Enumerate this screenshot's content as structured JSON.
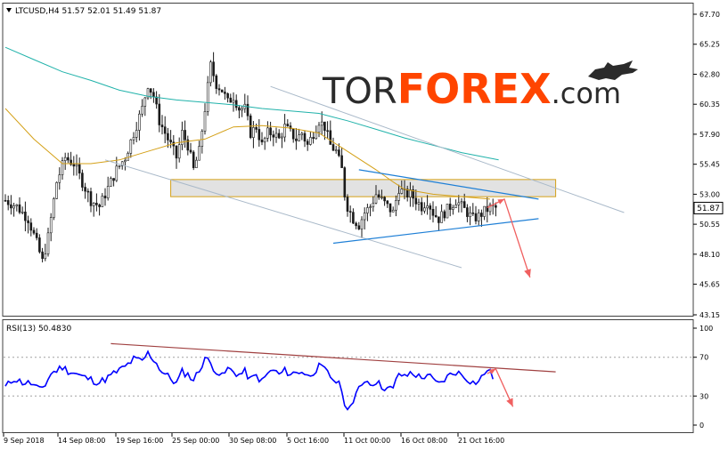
{
  "header": {
    "symbol_line": "LTCUSD,H4  51.57 52.01 51.49 51.87",
    "rsi_line": "RSI(13) 50.4830"
  },
  "watermark": {
    "part1": "TOR",
    "part2": "FOREX",
    "part3": ".com",
    "colors": {
      "tor": "#2b2b2b",
      "forex": "#ff4500",
      "com": "#2b2b2b"
    }
  },
  "colors": {
    "bars": "#1a1a1a",
    "ma_fast": "#d4a017",
    "ma_slow": "#20b2aa",
    "channel": "#a9b9c9",
    "triangle": "#1e7fd6",
    "zone_fill": "#e2e2e2",
    "zone_stroke": "#d4a017",
    "forecast": "#f06060",
    "rsi_line": "#0000ff",
    "rsi_trend": "#a04040",
    "level_grid": "#a0a0a0"
  },
  "chart_data": [
    {
      "type": "candlestick",
      "title": "LTCUSD,H4",
      "ohlc_last": {
        "open": 51.57,
        "high": 52.01,
        "low": 51.49,
        "close": 51.87
      },
      "current_price_label": "51.87",
      "ylim": [
        43.15,
        68.5
      ],
      "y_ticks": [
        "67.70",
        "65.25",
        "62.80",
        "60.35",
        "57.90",
        "55.45",
        "53.00",
        "50.55",
        "48.10",
        "45.65",
        "43.15"
      ],
      "x_ticks": [
        "9 Sep 2018",
        "14 Sep 08:00",
        "19 Sep 16:00",
        "25 Sep 00:00",
        "30 Sep 08:00",
        "5 Oct 16:00",
        "11 Oct 00:00",
        "16 Oct 08:00",
        "21 Oct 16:00"
      ],
      "bars_count": 180,
      "close_path": [
        [
          0,
          52.5
        ],
        [
          4,
          52.0
        ],
        [
          8,
          51.0
        ],
        [
          11,
          49.0
        ],
        [
          13,
          47.5
        ],
        [
          15,
          49.5
        ],
        [
          18,
          54.0
        ],
        [
          21,
          56.0
        ],
        [
          24,
          55.5
        ],
        [
          27,
          54.0
        ],
        [
          30,
          52.5
        ],
        [
          33,
          52.0
        ],
        [
          36,
          53.5
        ],
        [
          39,
          55.0
        ],
        [
          42,
          56.0
        ],
        [
          45,
          58.0
        ],
        [
          48,
          60.0
        ],
        [
          50,
          62.0
        ],
        [
          52,
          61.0
        ],
        [
          54,
          59.0
        ],
        [
          56,
          58.0
        ],
        [
          58,
          57.0
        ],
        [
          60,
          56.0
        ],
        [
          62,
          58.0
        ],
        [
          64,
          57.0
        ],
        [
          66,
          55.0
        ],
        [
          68,
          56.5
        ],
        [
          70,
          60.0
        ],
        [
          72,
          63.5
        ],
        [
          74,
          62.0
        ],
        [
          76,
          61.5
        ],
        [
          78,
          60.5
        ],
        [
          80,
          61.0
        ],
        [
          82,
          60.0
        ],
        [
          84,
          60.0
        ],
        [
          86,
          58.0
        ],
        [
          88,
          58.5
        ],
        [
          90,
          57.0
        ],
        [
          92,
          58.0
        ],
        [
          94,
          58.0
        ],
        [
          96,
          57.5
        ],
        [
          98,
          58.5
        ],
        [
          100,
          58.0
        ],
        [
          102,
          57.5
        ],
        [
          104,
          58.0
        ],
        [
          106,
          57.0
        ],
        [
          108,
          58.0
        ],
        [
          110,
          59.0
        ],
        [
          112,
          58.5
        ],
        [
          114,
          57.0
        ],
        [
          116,
          56.5
        ],
        [
          118,
          55.0
        ],
        [
          119,
          53.0
        ],
        [
          120,
          52.0
        ],
        [
          122,
          51.0
        ],
        [
          124,
          50.5
        ],
        [
          126,
          51.5
        ],
        [
          128,
          52.0
        ],
        [
          130,
          53.0
        ],
        [
          132,
          52.5
        ],
        [
          134,
          52.0
        ],
        [
          136,
          51.5
        ],
        [
          138,
          53.5
        ],
        [
          140,
          53.0
        ],
        [
          142,
          53.0
        ],
        [
          144,
          52.5
        ],
        [
          146,
          52.0
        ],
        [
          148,
          52.5
        ],
        [
          150,
          51.5
        ],
        [
          152,
          51.0
        ],
        [
          154,
          51.5
        ],
        [
          156,
          52.0
        ],
        [
          158,
          52.5
        ],
        [
          160,
          52.0
        ],
        [
          162,
          51.5
        ],
        [
          164,
          51.0
        ],
        [
          166,
          51.2
        ],
        [
          168,
          51.6
        ],
        [
          170,
          51.9
        ],
        [
          172,
          51.87
        ]
      ],
      "ma_fast": [
        [
          0,
          60.0
        ],
        [
          10,
          57.5
        ],
        [
          20,
          55.5
        ],
        [
          30,
          55.5
        ],
        [
          40,
          55.8
        ],
        [
          50,
          56.5
        ],
        [
          60,
          57.2
        ],
        [
          70,
          57.5
        ],
        [
          80,
          58.5
        ],
        [
          90,
          58.6
        ],
        [
          100,
          58.4
        ],
        [
          110,
          58.0
        ],
        [
          120,
          56.5
        ],
        [
          130,
          55.0
        ],
        [
          136,
          54.0
        ],
        [
          140,
          53.4
        ],
        [
          150,
          53.0
        ],
        [
          160,
          52.8
        ],
        [
          170,
          52.6
        ]
      ],
      "ma_slow": [
        [
          0,
          65.0
        ],
        [
          10,
          64.0
        ],
        [
          20,
          63.0
        ],
        [
          30,
          62.3
        ],
        [
          40,
          61.5
        ],
        [
          50,
          61.0
        ],
        [
          60,
          60.7
        ],
        [
          70,
          60.5
        ],
        [
          80,
          60.3
        ],
        [
          90,
          60.0
        ],
        [
          100,
          59.8
        ],
        [
          110,
          59.6
        ],
        [
          120,
          59.0
        ],
        [
          130,
          58.3
        ],
        [
          140,
          57.6
        ],
        [
          150,
          57.0
        ],
        [
          160,
          56.4
        ],
        [
          173,
          55.8
        ]
      ],
      "channel_upper": [
        [
          93,
          61.8
        ],
        [
          217,
          51.5
        ]
      ],
      "channel_lower": [
        [
          35,
          55.8
        ],
        [
          160,
          47.0
        ]
      ],
      "triangle_upper": [
        [
          124,
          55.0
        ],
        [
          187,
          52.6
        ]
      ],
      "triangle_lower": [
        [
          115,
          49.0
        ],
        [
          187,
          51.0
        ]
      ],
      "resistance_zone": [
        [
          58,
          54.2
        ],
        [
          193,
          52.8
        ]
      ],
      "forecast_path": [
        [
          169,
          51.9
        ],
        [
          175,
          52.6
        ],
        [
          184,
          46.2
        ]
      ]
    },
    {
      "type": "line",
      "title": "RSI(13)",
      "current": 50.483,
      "ylim": [
        0,
        100
      ],
      "y_ticks": [
        "100",
        "70",
        "30",
        "0"
      ],
      "levels": [
        70,
        30
      ],
      "values": [
        [
          0,
          39
        ],
        [
          3,
          48
        ],
        [
          6,
          44
        ],
        [
          9,
          43
        ],
        [
          12,
          36
        ],
        [
          14,
          42
        ],
        [
          16,
          53
        ],
        [
          20,
          60
        ],
        [
          22,
          56
        ],
        [
          24,
          54
        ],
        [
          27,
          50
        ],
        [
          30,
          47
        ],
        [
          33,
          44
        ],
        [
          36,
          49
        ],
        [
          39,
          55
        ],
        [
          42,
          60
        ],
        [
          45,
          68
        ],
        [
          48,
          66
        ],
        [
          50,
          74
        ],
        [
          52,
          68
        ],
        [
          55,
          55
        ],
        [
          58,
          48
        ],
        [
          60,
          43
        ],
        [
          62,
          55
        ],
        [
          64,
          52
        ],
        [
          66,
          47
        ],
        [
          68,
          56
        ],
        [
          70,
          70
        ],
        [
          72,
          63
        ],
        [
          74,
          56
        ],
        [
          76,
          50
        ],
        [
          78,
          58
        ],
        [
          80,
          55
        ],
        [
          82,
          52
        ],
        [
          84,
          55
        ],
        [
          86,
          47
        ],
        [
          88,
          51
        ],
        [
          90,
          45
        ],
        [
          92,
          53
        ],
        [
          94,
          57
        ],
        [
          96,
          52
        ],
        [
          98,
          56
        ],
        [
          100,
          53
        ],
        [
          102,
          54
        ],
        [
          104,
          56
        ],
        [
          106,
          50
        ],
        [
          108,
          55
        ],
        [
          110,
          60
        ],
        [
          112,
          57
        ],
        [
          114,
          50
        ],
        [
          116,
          45
        ],
        [
          118,
          38
        ],
        [
          119,
          18
        ],
        [
          120,
          20
        ],
        [
          122,
          22
        ],
        [
          124,
          38
        ],
        [
          126,
          47
        ],
        [
          128,
          43
        ],
        [
          130,
          45
        ],
        [
          132,
          40
        ],
        [
          134,
          38
        ],
        [
          136,
          37
        ],
        [
          138,
          54
        ],
        [
          140,
          49
        ],
        [
          142,
          54
        ],
        [
          144,
          52
        ],
        [
          146,
          48
        ],
        [
          148,
          53
        ],
        [
          150,
          46
        ],
        [
          152,
          42
        ],
        [
          154,
          47
        ],
        [
          156,
          52
        ],
        [
          158,
          55
        ],
        [
          160,
          52
        ],
        [
          162,
          48
        ],
        [
          164,
          44
        ],
        [
          166,
          45
        ],
        [
          168,
          53
        ],
        [
          169,
          58
        ],
        [
          171,
          50
        ]
      ],
      "trendline": [
        [
          37,
          84
        ],
        [
          193,
          55
        ]
      ],
      "forecast_path": [
        [
          169,
          53
        ],
        [
          172,
          58
        ],
        [
          178,
          19
        ]
      ]
    }
  ]
}
